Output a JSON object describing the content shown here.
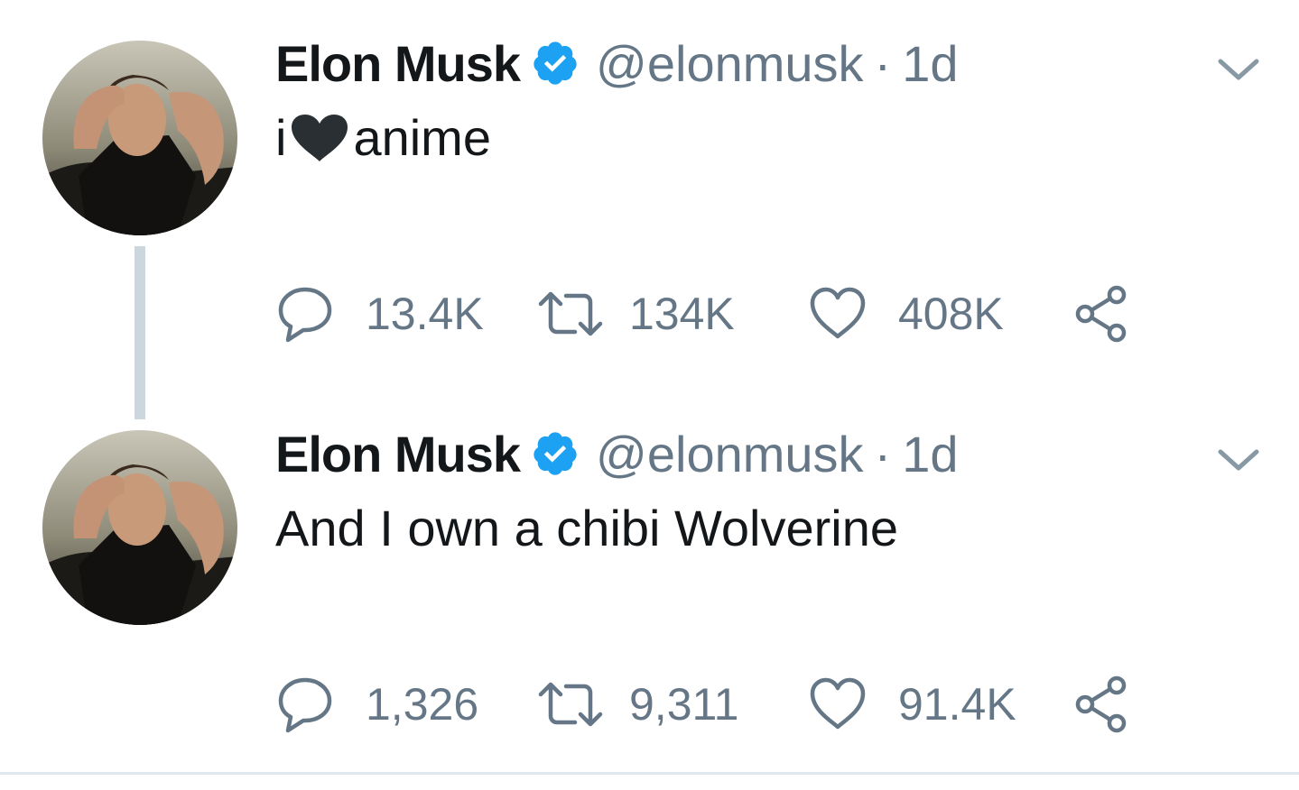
{
  "colors": {
    "text": "#14171a",
    "secondary": "#657786",
    "verified": "#1da1f2",
    "thread_line": "#ccd6dd",
    "divider": "#e1e8ed"
  },
  "tweets": [
    {
      "name": "Elon Musk",
      "handle": "@elonmusk",
      "separator": "·",
      "time": "1d",
      "text_before": "i",
      "text_emoji": "black-heart",
      "text_after": "anime",
      "replies": "13.4K",
      "retweets": "134K",
      "likes": "408K"
    },
    {
      "name": "Elon Musk",
      "handle": "@elonmusk",
      "separator": "·",
      "time": "1d",
      "text": "And I own a chibi Wolverine",
      "replies": "1,326",
      "retweets": "9,311",
      "likes": "91.4K"
    }
  ]
}
